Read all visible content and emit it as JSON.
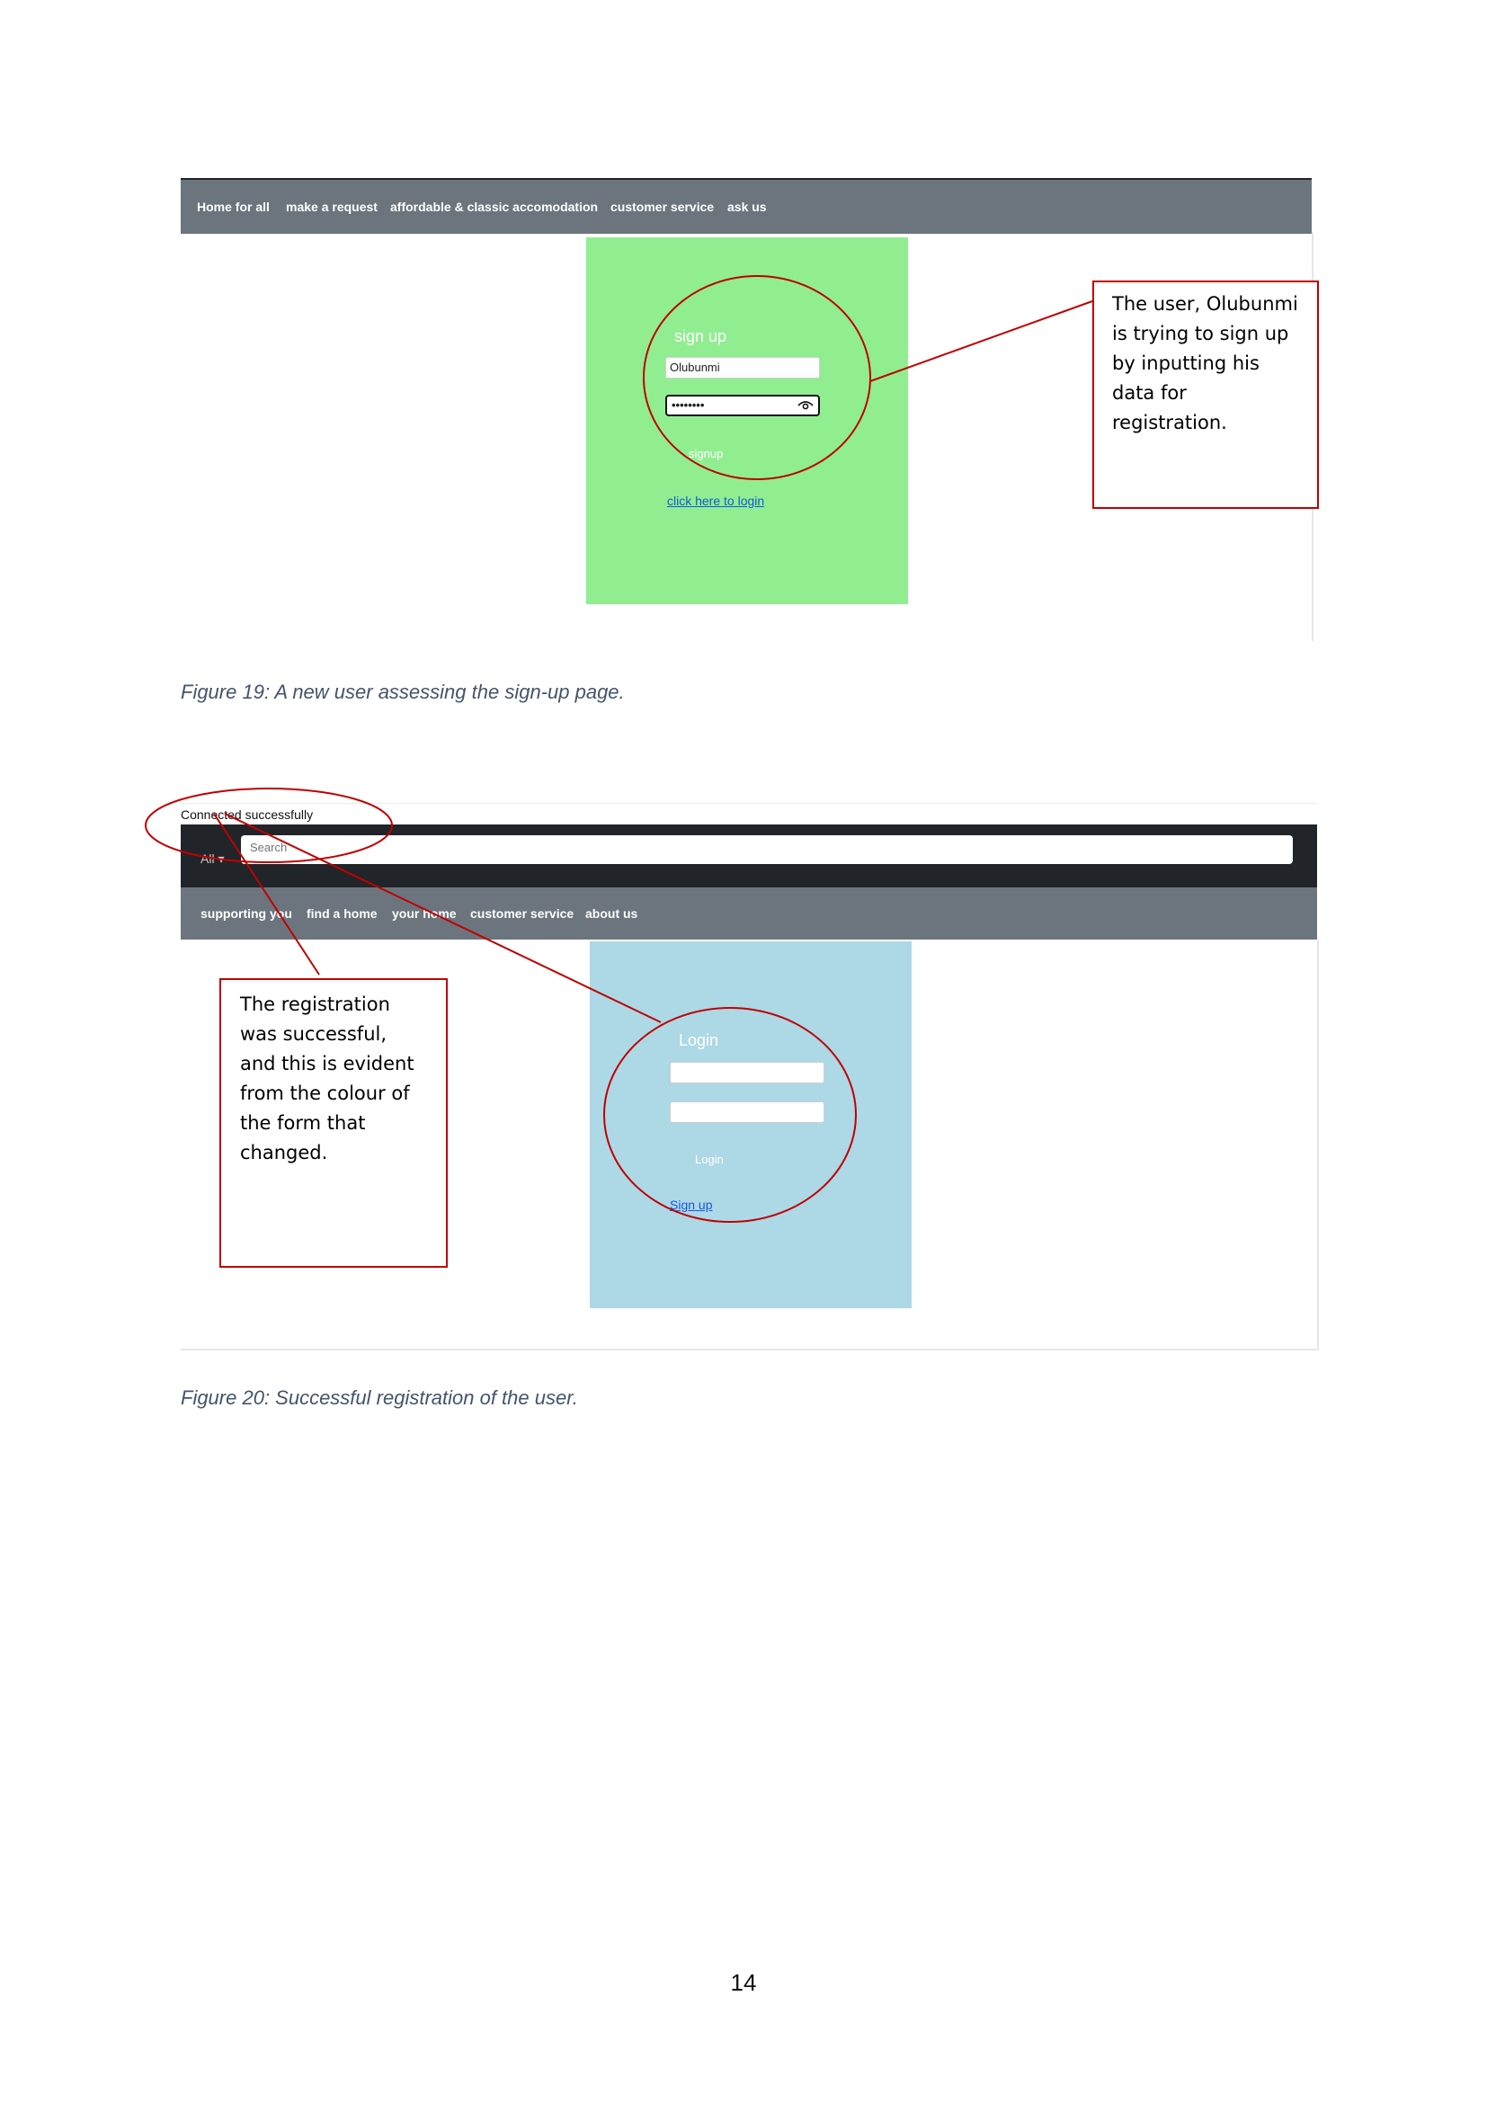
{
  "figure19": {
    "nav_items": [
      "Home for all",
      "make a request",
      "affordable & classic accomodation",
      "customer service",
      "ask us"
    ],
    "form": {
      "title": "sign up",
      "username_value": "Olubunmi",
      "password_value": "••••••••",
      "submit_label": "signup",
      "login_link": "click here to login",
      "background": "#90ee90"
    },
    "callout": "The user, Olubunmi is trying to sign up by inputting his data for registration.",
    "caption": "Figure 19:  A new user assessing the sign-up page."
  },
  "figure20": {
    "status_text": "Connected successfully",
    "search": {
      "dropdown_label": "All ▾",
      "placeholder": "Search"
    },
    "nav_items": [
      "supporting you",
      "find a home",
      "your home",
      "customer service",
      "about us"
    ],
    "form": {
      "title": "Login",
      "username_value": "",
      "password_value": "",
      "submit_label": "Login",
      "signup_link": "Sign up",
      "background": "#add8e6"
    },
    "callout": "The registration was successful, and this is evident from the colour of the form that changed.",
    "caption": "Figure 20: Successful registration of the user."
  },
  "annotation_color": "#c00000",
  "page_number": "14"
}
